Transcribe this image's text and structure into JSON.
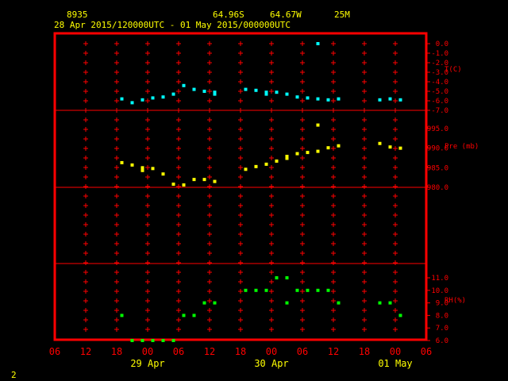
{
  "header": {
    "station": "8935",
    "lat": "64.96S",
    "lon": "64.67W",
    "elev": "25M",
    "period": "28 Apr 2015/120000UTC - 01 May 2015/000000UTC"
  },
  "corner_label": "2",
  "colors": {
    "frame": "#ff0000",
    "temp": "#00ffff",
    "pres": "#ffff00",
    "rh": "#00ff00",
    "text": "#ffff00"
  },
  "chart_data": {
    "type": "scatter",
    "x_unit": "hours from 28 Apr 2015 06 UTC",
    "xlim": [
      0,
      72
    ],
    "x_tick_labels": [
      "06",
      "12",
      "18",
      "00",
      "06",
      "12",
      "18",
      "00",
      "06",
      "12",
      "18",
      "00",
      "06"
    ],
    "date_labels": [
      {
        "text": "29 Apr",
        "x": 18
      },
      {
        "text": "30 Apr",
        "x": 42
      },
      {
        "text": "01 May",
        "x": 66
      }
    ],
    "panels": [
      {
        "name": "T(C)",
        "ylim": [
          -7,
          0
        ],
        "ticks": [
          "0.0",
          "-1.0",
          "-2.0",
          "-3.0",
          "-4.0",
          "-5.0",
          "-6.0",
          "-7.0"
        ],
        "tick_values": [
          0,
          -1,
          -2,
          -3,
          -4,
          -5,
          -6,
          -7
        ],
        "points": [
          [
            13,
            -5.8
          ],
          [
            15,
            -6.2
          ],
          [
            17,
            -5.9
          ],
          [
            19,
            -5.7
          ],
          [
            21,
            -5.6
          ],
          [
            23,
            -5.3
          ],
          [
            25,
            -4.4
          ],
          [
            27,
            -4.8
          ],
          [
            29,
            -5.0
          ],
          [
            31,
            -5.1
          ],
          [
            31,
            -5.3
          ],
          [
            37,
            -4.8
          ],
          [
            39,
            -4.9
          ],
          [
            41,
            -5.1
          ],
          [
            41,
            -5.3
          ],
          [
            43,
            -5.1
          ],
          [
            45,
            -5.3
          ],
          [
            47,
            -5.6
          ],
          [
            49,
            -5.7
          ],
          [
            51,
            -5.8
          ],
          [
            53,
            -5.9
          ],
          [
            55,
            -5.8
          ],
          [
            51,
            0.0
          ],
          [
            63,
            -5.9
          ],
          [
            65,
            -5.8
          ],
          [
            67,
            -5.9
          ]
        ]
      },
      {
        "name": "Pre (mb)",
        "ylim": [
          980,
          998
        ],
        "ticks": [
          "995.0",
          "990.0",
          "985.0",
          "980.0"
        ],
        "tick_values": [
          995,
          990,
          985,
          980
        ],
        "points": [
          [
            13,
            986.3
          ],
          [
            15,
            985.7
          ],
          [
            17,
            985.0
          ],
          [
            17,
            984.3
          ],
          [
            19,
            984.8
          ],
          [
            21,
            983.4
          ],
          [
            23,
            980.8
          ],
          [
            25,
            980.6
          ],
          [
            27,
            982.0
          ],
          [
            29,
            982.0
          ],
          [
            31,
            981.5
          ],
          [
            37,
            984.6
          ],
          [
            39,
            985.3
          ],
          [
            41,
            985.9
          ],
          [
            43,
            986.7
          ],
          [
            45,
            987.4
          ],
          [
            45,
            987.9
          ],
          [
            47,
            988.6
          ],
          [
            49,
            988.9
          ],
          [
            51,
            989.2
          ],
          [
            51,
            995.9
          ],
          [
            53,
            990.1
          ],
          [
            55,
            990.6
          ],
          [
            63,
            991.2
          ],
          [
            65,
            990.3
          ],
          [
            67,
            990.0
          ]
        ]
      },
      {
        "name": "RH(%)",
        "ylim": [
          6,
          11.5
        ],
        "ticks": [
          "11.0",
          "10.0",
          "9.0",
          "8.0",
          "7.0",
          "6.0"
        ],
        "tick_values": [
          11,
          10,
          9,
          8,
          7,
          6
        ],
        "points": [
          [
            13,
            8.0
          ],
          [
            15,
            6.0
          ],
          [
            17,
            6.0
          ],
          [
            19,
            6.0
          ],
          [
            21,
            6.0
          ],
          [
            23,
            6.0
          ],
          [
            25,
            8.0
          ],
          [
            27,
            8.0
          ],
          [
            29,
            9.0
          ],
          [
            31,
            9.0
          ],
          [
            37,
            10.0
          ],
          [
            39,
            10.0
          ],
          [
            41,
            10.0
          ],
          [
            43,
            11.0
          ],
          [
            45,
            11.0
          ],
          [
            45,
            9.0
          ],
          [
            47,
            10.0
          ],
          [
            49,
            10.0
          ],
          [
            51,
            10.0
          ],
          [
            53,
            10.0
          ],
          [
            55,
            9.0
          ],
          [
            63,
            9.0
          ],
          [
            65,
            9.0
          ],
          [
            67,
            8.0
          ]
        ]
      }
    ]
  }
}
